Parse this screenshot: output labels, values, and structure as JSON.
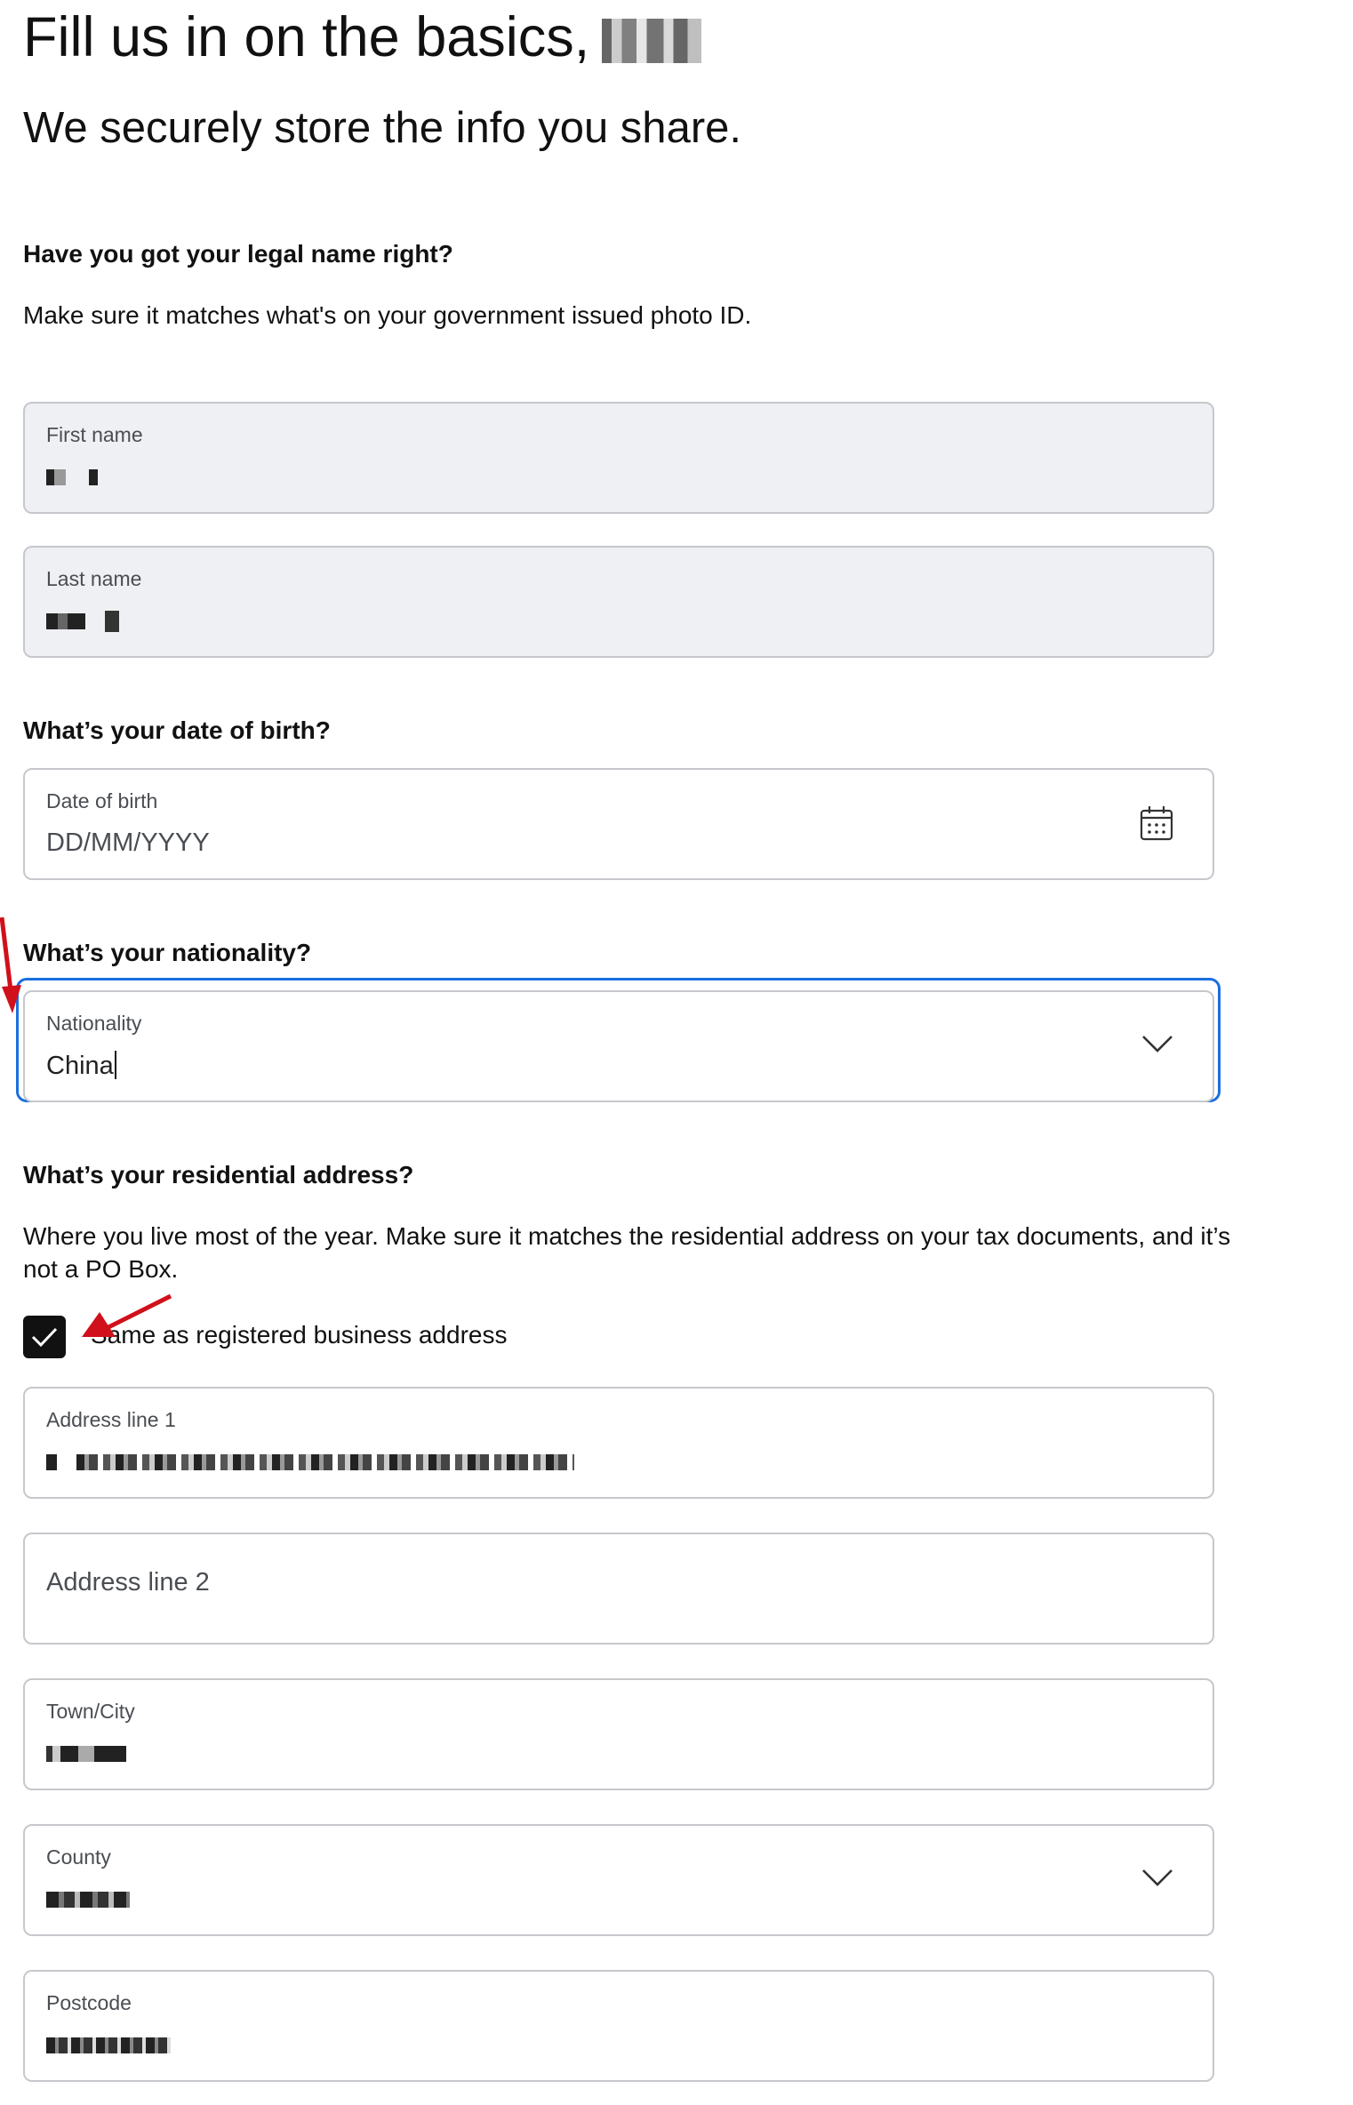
{
  "header": {
    "title": "Fill us in on the basics,",
    "subtitle": "We securely store the info you share."
  },
  "legal_name": {
    "question": "Have you got your legal name right?",
    "help": "Make sure it matches what's on your government issued photo ID.",
    "first_name_label": "First name",
    "last_name_label": "Last name"
  },
  "dob": {
    "question": "What’s your date of birth?",
    "label": "Date of birth",
    "placeholder": "DD/MM/YYYY",
    "icon": "calendar-icon"
  },
  "nationality": {
    "question": "What’s your nationality?",
    "label": "Nationality",
    "value": "China",
    "icon": "chevron-down-icon"
  },
  "address": {
    "question": "What’s your residential address?",
    "help": "Where you live most of the year. Make sure it matches the residential address on your tax documents, and it’s not a PO Box.",
    "same_as_business_label": "Same as registered business address",
    "same_as_business_checked": true,
    "line1_label": "Address line 1",
    "line2_placeholder": "Address line 2",
    "town_label": "Town/City",
    "county_label": "County",
    "postcode_label": "Postcode"
  },
  "colors": {
    "focus": "#1a6fe0",
    "annotation_arrow": "#d0101b",
    "field_border": "#c6c8cc",
    "filled_bg": "#eff0f3"
  }
}
